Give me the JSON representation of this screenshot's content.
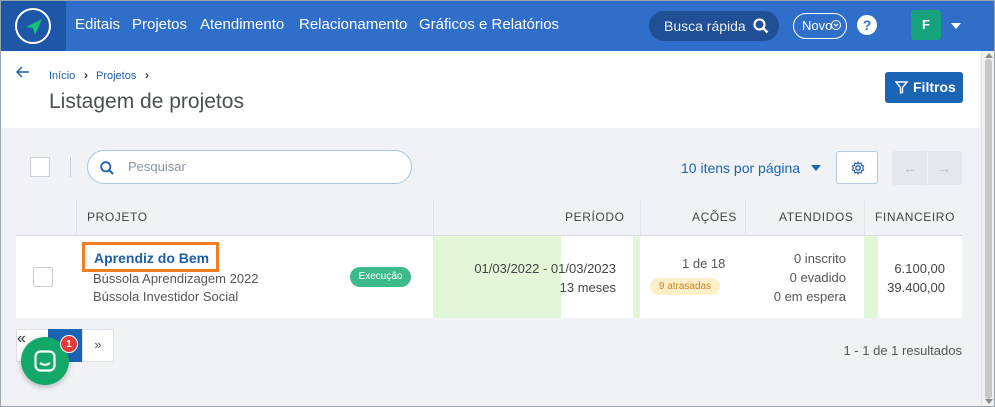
{
  "nav": {
    "items": [
      "Editais",
      "Projetos",
      "Atendimento",
      "Relacionamento",
      "Gráficos e Relatórios"
    ],
    "quick_search": "Busca rápida",
    "new_label": "Novo",
    "help": "?",
    "avatar_initial": "F"
  },
  "breadcrumb": {
    "home": "Início",
    "projects": "Projetos"
  },
  "page": {
    "title": "Listagem de projetos",
    "filter_label": "Filtros"
  },
  "toolbar": {
    "search_placeholder": "Pesquisar",
    "per_page": "10 itens por página",
    "prev": "←",
    "next": "→"
  },
  "table": {
    "headers": [
      "PROJETO",
      "PERÍODO",
      "AÇÕES",
      "ATENDIDOS",
      "FINANCEIRO"
    ],
    "rows": [
      {
        "name": "Aprendiz do Bem",
        "programs": [
          "Bússola Aprendizagem 2022",
          "Bússola Investidor Social"
        ],
        "status": "Execução",
        "period": "01/03/2022 - 01/03/2023",
        "duration": "13 meses",
        "actions": "1 de 18",
        "late": "9 atrasadas",
        "enrolled": "0 inscrito",
        "dropped": "0 evadido",
        "waiting": "0 em espera",
        "financial": [
          "6.100,00",
          "39.400,00"
        ]
      }
    ]
  },
  "pagination": {
    "prev": "«",
    "current": "1",
    "next": "»",
    "results": "1 - 1 de 1 resultados"
  },
  "chat": {
    "badge": "1"
  },
  "colors": {
    "nav": "#2f6ec9",
    "accent": "#1b63b3",
    "status": "#3dba8a",
    "highlight": "#f28023"
  }
}
